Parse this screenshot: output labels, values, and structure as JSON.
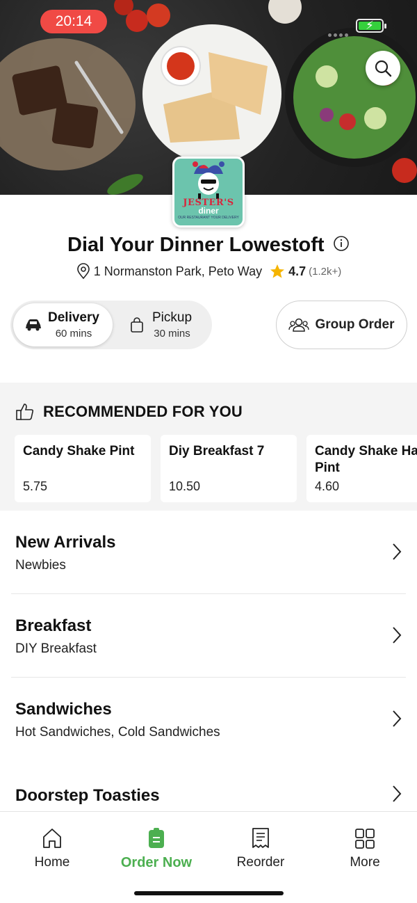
{
  "status": {
    "time": "20:14"
  },
  "restaurant": {
    "logo_line1": "JESTER'S",
    "logo_line2": "diner",
    "logo_line3": "OUR RESTAURANT YOUR DELIVERY",
    "name": "Dial Your Dinner Lowestoft",
    "address": "1 Normanston Park, Peto Way",
    "rating": "4.7",
    "rating_count": "(1.2k+)"
  },
  "order_mode": {
    "delivery": {
      "label": "Delivery",
      "time": "60 mins",
      "selected": true
    },
    "pickup": {
      "label": "Pickup",
      "time": "30 mins",
      "selected": false
    },
    "group_order_label": "Group Order"
  },
  "recommended": {
    "title": "RECOMMENDED FOR YOU",
    "items": [
      {
        "name": "Candy Shake Pint",
        "price": "5.75"
      },
      {
        "name": "Diy Breakfast 7",
        "price": "10.50"
      },
      {
        "name": "Candy Shake Half Pint",
        "price": "4.60"
      }
    ]
  },
  "categories": [
    {
      "name": "New Arrivals",
      "subtitle": "Newbies"
    },
    {
      "name": "Breakfast",
      "subtitle": "DIY Breakfast"
    },
    {
      "name": "Sandwiches",
      "subtitle": "Hot Sandwiches, Cold Sandwiches"
    },
    {
      "name": "Doorstep Toasties",
      "subtitle": ""
    }
  ],
  "nav": [
    {
      "label": "Home",
      "icon": "home-icon"
    },
    {
      "label": "Order Now",
      "icon": "order-icon",
      "active": true
    },
    {
      "label": "Reorder",
      "icon": "receipt-icon"
    },
    {
      "label": "More",
      "icon": "grid-icon"
    }
  ],
  "colors": {
    "accent": "#4caf50",
    "status_red": "#f04a45",
    "star": "#f5b400"
  }
}
